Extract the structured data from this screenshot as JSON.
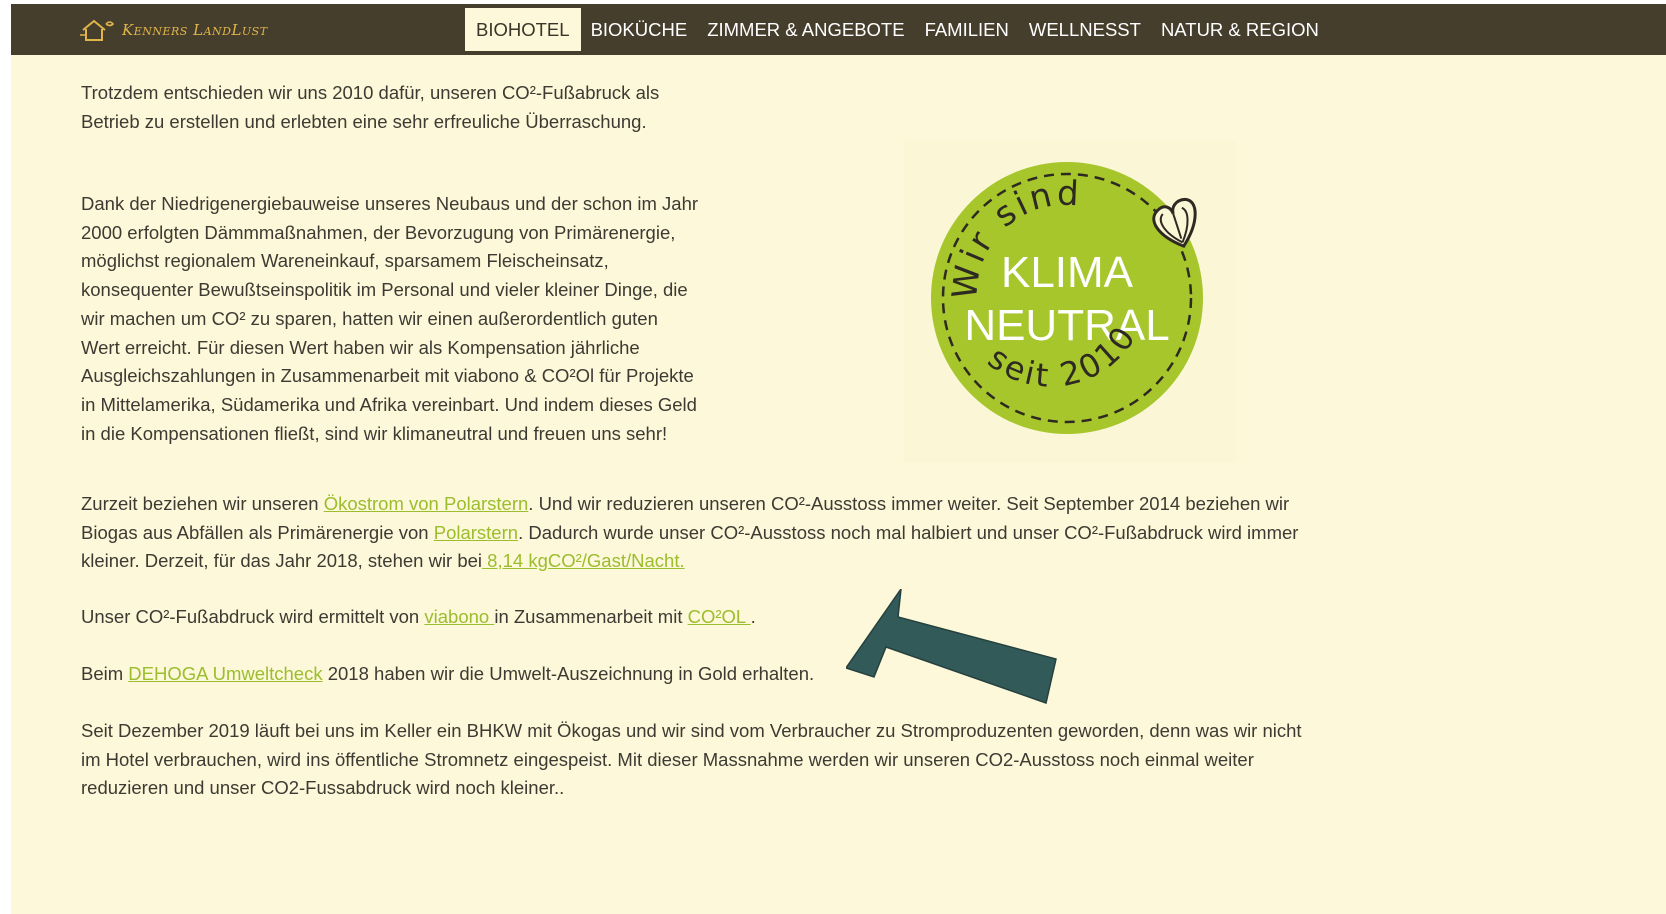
{
  "header": {
    "logo_text": "Kenners LandLust",
    "menu": [
      {
        "label": "BIOHOTEL",
        "active": true
      },
      {
        "label": "BIOKÜCHE",
        "active": false
      },
      {
        "label": "ZIMMER & ANGEBOTE",
        "active": false
      },
      {
        "label": "FAMILIEN",
        "active": false
      },
      {
        "label": "WELLNESST",
        "active": false
      },
      {
        "label": "NATUR & REGION",
        "active": false
      }
    ]
  },
  "badge": {
    "top_arc": "Wir sind",
    "line1": "KLIMA",
    "line2": "NEUTRAL",
    "bottom_arc": "seit 2010",
    "color": "#a6c62c"
  },
  "content": {
    "p1": "Trotzdem entschieden wir uns 2010 dafür, unseren CO²-Fußabruck als Betrieb  zu erstellen und erlebten eine sehr erfreuliche Überraschung.",
    "p2": "Dank der Niedrigenergiebauweise unseres Neubaus und der schon im Jahr 2000 erfolgten Dämmmaßnahmen, der Bevorzugung von Primärenergie, möglichst regionalem Wareneinkauf, sparsamem Fleischeinsatz, konsequenter Bewußtseinspolitik im Personal und vieler kleiner Dinge, die wir machen um CO² zu sparen, hatten wir einen außerordentlich guten Wert erreicht. Für diesen Wert haben wir als Kompensation jährliche Ausgleichszahlungen in Zusammenarbeit mit viabono & CO²Ol für Projekte in Mittelamerika, Südamerika und Afrika vereinbart. Und indem dieses Geld in die Kompensationen fließt, sind wir klimaneutral und freuen uns sehr!",
    "p3": {
      "t1": "Zurzeit beziehen wir unseren ",
      "link1": "Ökostrom von Polarstern",
      "t2": ". Und wir reduzieren unseren CO²-Ausstoss immer weiter. Seit September 2014 beziehen wir Biogas aus Abfällen als Primärenergie von ",
      "link2": "Polarstern",
      "t3": ". Dadurch wurde unser CO²-Ausstoss noch mal halbiert und unser CO²-Fußabdruck wird immer kleiner. Derzeit, für das Jahr 2018, stehen wir bei",
      "link3": " 8,14 kgCO²/Gast/Nacht."
    },
    "p4": {
      "t1": "Unser CO²-Fußabdruck wird ermittelt von ",
      "link1": "viabono ",
      "t2": "in Zusammenarbeit mit ",
      "link2": "CO²OL ",
      "t3": "."
    },
    "p5": {
      "t1": "Beim ",
      "link1": "DEHOGA Umweltcheck",
      "t2": " 2018 haben wir die Umwelt-Auszeichnung in Gold erhalten."
    },
    "p6": "Seit Dezember 2019 läuft bei uns im Keller ein BHKW mit Ökogas und wir sind vom Verbraucher zu Stromproduzenten geworden, denn was wir nicht im Hotel verbrauchen, wird ins öffentliche Stromnetz eingespeist. Mit dieser Massnahme werden wir unseren CO2-Ausstoss noch einmal weiter reduzieren und unser CO2-Fussabdruck wird noch kleiner.."
  },
  "colors": {
    "nav_bg": "#463e2d",
    "page_bg": "#fcf8d9",
    "link": "#9cbd2e",
    "arrow": "#325a58"
  }
}
